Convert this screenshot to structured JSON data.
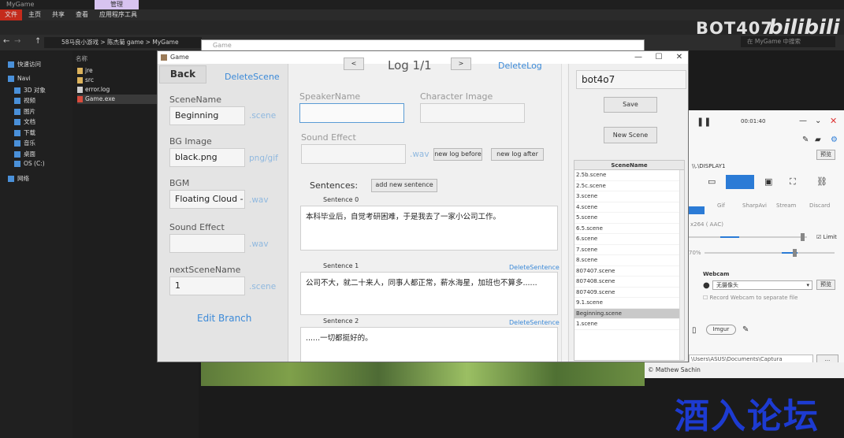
{
  "explorer": {
    "title": "MyGame",
    "manage_tab": "管理",
    "tabs": [
      "文件",
      "主页",
      "共享",
      "查看",
      "应用程序工具"
    ],
    "breadcrumb": [
      "58马良小游戏",
      "陈杰菊 game",
      "MyGame"
    ],
    "search_placeholder": "在 MyGame 中搜索",
    "column_header": "名称",
    "files": [
      {
        "name": "jre",
        "type": "folder"
      },
      {
        "name": "src",
        "type": "folder"
      },
      {
        "name": "error.log",
        "type": "file"
      },
      {
        "name": "Game.exe",
        "type": "file"
      }
    ],
    "nav": [
      "快速访问",
      "Navi",
      "3D 对象",
      "视频",
      "图片",
      "文档",
      "下载",
      "音乐",
      "桌面",
      "OS (C:)",
      "网络"
    ]
  },
  "bg_window_title": "Game",
  "watermark": {
    "bot": "BOT407",
    "site": "bilibili",
    "forum": "酒入论坛"
  },
  "window": {
    "title": "Game",
    "controls": [
      "—",
      "☐",
      "✕"
    ]
  },
  "left": {
    "back_label": "Back",
    "delete_scene_label": "DeleteScene",
    "scene_name_label": "SceneName",
    "scene_name_value": "Beginning",
    "scene_ext": ".scene",
    "bg_image_label": "BG Image",
    "bg_image_value": "black.png",
    "bg_image_ext": "png/gif",
    "bgm_label": "BGM",
    "bgm_value": "Floating Cloud - !",
    "bgm_ext": ".wav",
    "sound_effect_label": "Sound Effect",
    "sound_effect_value": "",
    "sound_effect_ext": ".wav",
    "next_scene_label": "nextSceneName",
    "next_scene_value": "1",
    "next_scene_ext": ".scene",
    "edit_branch_label": "Edit Branch"
  },
  "middle": {
    "log_title": "Log 1/1",
    "delete_log_label": "DeleteLog",
    "speaker_name_label": "SpeakerName",
    "speaker_name_value": "",
    "character_image_label": "Character Image",
    "character_image_value": "",
    "sound_effect_label": "Sound Effect",
    "sound_effect_value": "",
    "sound_effect_ext": ".wav",
    "new_log_before": "new log before",
    "new_log_after": "new log after",
    "sentences_label": "Sentences:",
    "add_sentence_label": "add new sentence",
    "sentences": [
      {
        "label": "Sentence 0",
        "text": "本科毕业后，自觉考研困难，于是我去了一家小公司工作。",
        "delete": ""
      },
      {
        "label": "Sentence 1",
        "text": "公司不大，就二十来人，同事人都正常，薪水海星，加班也不算多......",
        "delete": "DeleteSentence"
      },
      {
        "label": "Sentence 2",
        "text": "......一切都挺好的。",
        "delete": "DeleteSentence"
      }
    ]
  },
  "right": {
    "project_name": "bot4o7",
    "save_label": "Save",
    "new_scene_label": "New Scene",
    "table_header": "SceneName",
    "scenes": [
      "2.5b.scene",
      "2.5c.scene",
      "3.scene",
      "4.scene",
      "5.scene",
      "6.5.scene",
      "6.scene",
      "7.scene",
      "8.scene",
      "807407.scene",
      "807408.scene",
      "807409.scene",
      "9.1.scene",
      "Beginning.scene",
      "1.scene"
    ],
    "selected_scene": "Beginning.scene"
  },
  "captura": {
    "timer": "00:01:40",
    "preview": "预览",
    "display": "\\\\.\\DISPLAY1",
    "encoder_tabs": [
      "Gif",
      "SharpAvi",
      "Stream",
      "Discard"
    ],
    "encoder": "x264 ( AAC)",
    "limit_label": "Limit",
    "percent": "70%",
    "webcam_label": "Webcam",
    "webcam_value": "无摄像头",
    "webcam_preview": "预览",
    "record_webcam": "Record Webcam to separate file",
    "imgur": "Imgur",
    "path": "\\Users\\ASUS\\Documents\\Captura",
    "more": "...",
    "credit": "© Mathew Sachin"
  }
}
